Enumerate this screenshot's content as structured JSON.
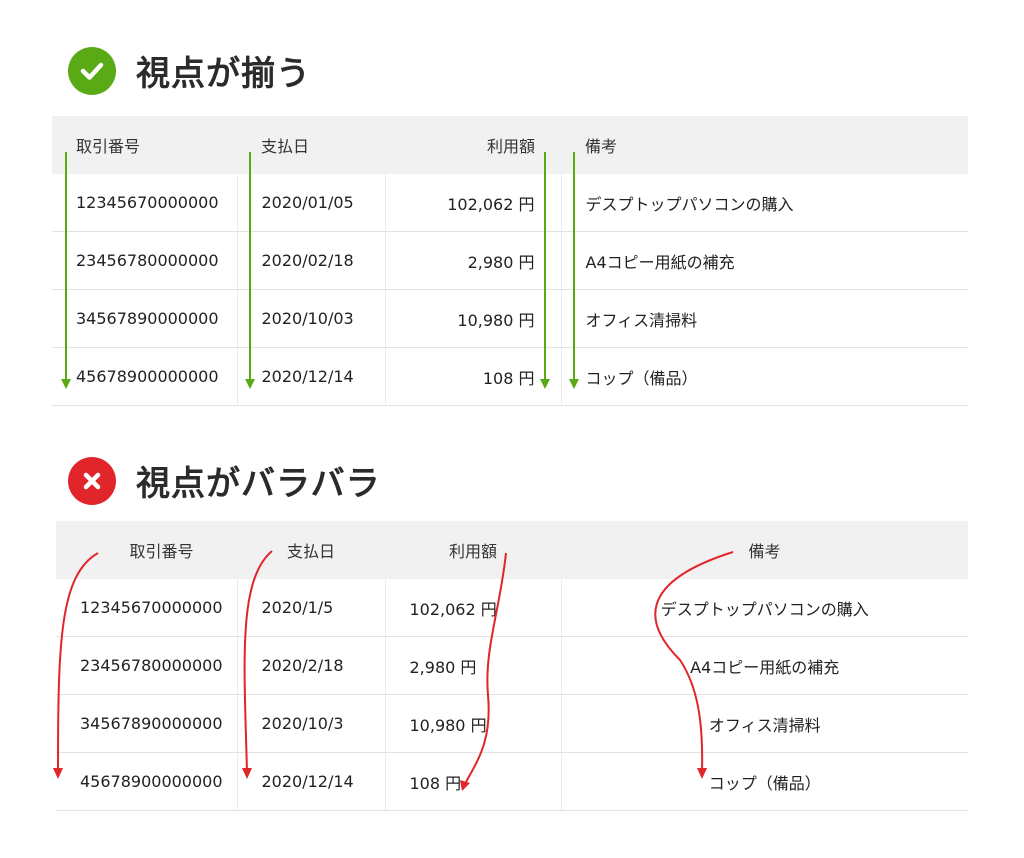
{
  "good": {
    "title": "視点が揃う",
    "headers": [
      "取引番号",
      "支払日",
      "利用額",
      "備考"
    ],
    "rows": [
      [
        "12345670000000",
        "2020/01/05",
        "102,062 円",
        "デスプトップパソコンの購入"
      ],
      [
        "23456780000000",
        "2020/02/18",
        "2,980 円",
        "A4コピー用紙の補充"
      ],
      [
        "34567890000000",
        "2020/10/03",
        "10,980 円",
        "オフィス清掃料"
      ],
      [
        "45678900000000",
        "2020/12/14",
        "108 円",
        "コップ（備品）"
      ]
    ]
  },
  "bad": {
    "title": "視点がバラバラ",
    "headers": [
      "取引番号",
      "支払日",
      "利用額",
      "備考"
    ],
    "rows": [
      [
        "12345670000000",
        "2020/1/5",
        "102,062 円",
        "デスプトップパソコンの購入"
      ],
      [
        "23456780000000",
        "2020/2/18",
        "2,980 円",
        "A4コピー用紙の補充"
      ],
      [
        "34567890000000",
        "2020/10/3",
        "10,980 円",
        "オフィス清掃料"
      ],
      [
        "45678900000000",
        "2020/12/14",
        "108 円",
        "コップ（備品）"
      ]
    ]
  },
  "colors": {
    "good": "#5aaa15",
    "bad": "#e0262b",
    "header_bg": "#f1f1f1"
  }
}
